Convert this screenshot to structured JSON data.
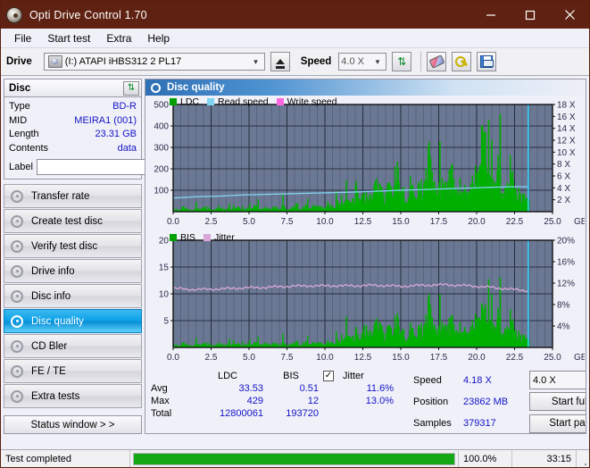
{
  "window": {
    "title": "Opti Drive Control 1.70",
    "icon": "disc-icon",
    "minimize": "minimize-icon",
    "maximize": "maximize-icon",
    "close": "close-icon"
  },
  "menu": {
    "items": [
      "File",
      "Start test",
      "Extra",
      "Help"
    ]
  },
  "toolbar": {
    "drive_label": "Drive",
    "drive_value": "(I:)   ATAPI iHBS312   2 PL17",
    "eject_icon": "eject-icon",
    "speed_label": "Speed",
    "speed_value": "4.0 X",
    "refresh_icon": "refresh-icon",
    "eraser_icon": "eraser-icon",
    "tools_icon": "tools-icon",
    "save_icon": "save-icon"
  },
  "disc": {
    "title": "Disc",
    "refresh_icon": "refresh-icon",
    "rows": [
      {
        "key": "Type",
        "value": "BD-R"
      },
      {
        "key": "MID",
        "value": "MEIRA1 (001)"
      },
      {
        "key": "Length",
        "value": "23.31 GB"
      },
      {
        "key": "Contents",
        "value": "data"
      }
    ],
    "label_key": "Label",
    "label_value": "",
    "label_placeholder": "",
    "disc_icon": "cd-icon"
  },
  "sidebar": {
    "items": [
      {
        "label": "Transfer rate",
        "active": false
      },
      {
        "label": "Create test disc",
        "active": false
      },
      {
        "label": "Verify test disc",
        "active": false
      },
      {
        "label": "Drive info",
        "active": false
      },
      {
        "label": "Disc info",
        "active": false
      },
      {
        "label": "Disc quality",
        "active": true
      },
      {
        "label": "CD Bler",
        "active": false
      },
      {
        "label": "FE / TE",
        "active": false
      },
      {
        "label": "Extra tests",
        "active": false
      }
    ],
    "status_window": "Status window > >"
  },
  "panel": {
    "title": "Disc quality",
    "icon": "disc-quality-icon"
  },
  "stats": {
    "col_headers": [
      "LDC",
      "BIS"
    ],
    "jitter_label": "Jitter",
    "jitter_checked": true,
    "rows": [
      {
        "key": "Avg",
        "ldc": "33.53",
        "bis": "0.51",
        "jitter": "11.6%"
      },
      {
        "key": "Max",
        "ldc": "429",
        "bis": "12",
        "jitter": "13.0%"
      },
      {
        "key": "Total",
        "ldc": "12800061",
        "bis": "193720",
        "jitter": ""
      }
    ],
    "speed_key": "Speed",
    "speed_value": "4.18 X",
    "speed_select": "4.0 X",
    "position_key": "Position",
    "position_value": "23862 MB",
    "samples_key": "Samples",
    "samples_value": "379317",
    "start_full": "Start full",
    "start_part": "Start part"
  },
  "statusbar": {
    "message": "Test completed",
    "percent": "100.0%",
    "percent_value": 100,
    "time": "33:15"
  },
  "colors": {
    "ldc_green": "#00b000",
    "read_speed_blue": "#7fd4f0",
    "write_speed_pink": "#ff66e0",
    "bis_green": "#00b000",
    "jitter_pink": "#d9a8d9",
    "plot_bg": "#6b7894",
    "grid": "#3a4358",
    "title_bar": "#5f2111",
    "accent_blue": "#1414c8",
    "progress_green": "#14a814"
  },
  "chart_data": [
    {
      "type": "area",
      "id": "ldc-chart",
      "title": "",
      "legend": [
        {
          "name": "LDC",
          "color": "#00a000"
        },
        {
          "name": "Read speed",
          "color": "#7fd4f0"
        },
        {
          "name": "Write speed",
          "color": "#ff66e0"
        }
      ],
      "legend_position": "top-left",
      "xlabel": "GB",
      "x_ticks": [
        "0.0",
        "2.5",
        "5.0",
        "7.5",
        "10.0",
        "12.5",
        "15.0",
        "17.5",
        "20.0",
        "22.5",
        "25.0"
      ],
      "xlim": [
        0.0,
        25.0
      ],
      "ylabel_left": "LDC",
      "y_ticks_left": [
        "100",
        "200",
        "300",
        "400",
        "500"
      ],
      "ylim_left": [
        0,
        500
      ],
      "ylabel_right": "Speed",
      "y_ticks_right": [
        "2 X",
        "4 X",
        "6 X",
        "8 X",
        "10 X",
        "12 X",
        "14 X",
        "16 X",
        "18 X"
      ],
      "ylim_right": [
        0,
        18
      ],
      "grid": true,
      "series": [
        {
          "name": "LDC",
          "color": "#00b000",
          "type": "vertical-bars",
          "x": [
            0.0,
            0.3,
            0.6,
            0.9,
            1.2,
            1.5,
            1.8,
            2.1,
            2.4,
            2.7,
            3.0,
            3.3,
            3.6,
            3.9,
            4.2,
            4.5,
            4.8,
            5.1,
            5.4,
            5.7,
            6.0,
            6.3,
            6.6,
            6.9,
            7.2,
            7.5,
            7.8,
            8.1,
            8.4,
            8.7,
            9.0,
            9.3,
            9.6,
            9.9,
            10.2,
            10.5,
            10.8,
            11.1,
            11.4,
            11.7,
            12.0,
            12.3,
            12.6,
            12.9,
            13.2,
            13.5,
            13.8,
            14.1,
            14.4,
            14.7,
            15.0,
            15.3,
            15.6,
            15.9,
            16.2,
            16.5,
            16.8,
            17.1,
            17.4,
            17.7,
            18.0,
            18.3,
            18.6,
            18.9,
            19.2,
            19.5,
            19.8,
            20.1,
            20.4,
            20.7,
            21.0,
            21.3,
            21.6,
            21.9,
            22.2,
            22.5,
            22.8,
            23.1,
            23.4
          ],
          "values": [
            14,
            10,
            22,
            12,
            9,
            18,
            11,
            25,
            14,
            10,
            30,
            12,
            16,
            11,
            28,
            9,
            18,
            13,
            35,
            11,
            20,
            14,
            26,
            12,
            32,
            10,
            22,
            40,
            16,
            30,
            14,
            38,
            18,
            26,
            50,
            20,
            44,
            28,
            60,
            34,
            120,
            75,
            95,
            62,
            110,
            150,
            85,
            130,
            100,
            240,
            115,
            90,
            175,
            96,
            140,
            105,
            300,
            120,
            98,
            160,
            104,
            230,
            112,
            145,
            108,
            125,
            190,
            155,
            430,
            175,
            120,
            260,
            142,
            118,
            250,
            108,
            95,
            70,
            60
          ]
        },
        {
          "name": "Read speed",
          "color": "#7fd4f0",
          "type": "line",
          "x": [
            0.0,
            1.5,
            3.0,
            4.5,
            6.0,
            7.5,
            9.0,
            10.5,
            12.0,
            13.5,
            15.0,
            16.5,
            18.0,
            19.5,
            21.0,
            22.5,
            23.4
          ],
          "values": [
            2.3,
            2.5,
            2.6,
            2.8,
            2.9,
            3.0,
            3.1,
            3.2,
            3.3,
            3.45,
            3.6,
            3.7,
            3.85,
            3.95,
            4.1,
            4.18,
            4.18
          ]
        }
      ],
      "vertical_marker_x": 23.4
    },
    {
      "type": "area",
      "id": "bis-chart",
      "title": "",
      "legend": [
        {
          "name": "BIS",
          "color": "#00a000"
        },
        {
          "name": "Jitter",
          "color": "#d9a8d9"
        }
      ],
      "legend_position": "top-left",
      "xlabel": "GB",
      "x_ticks": [
        "0.0",
        "2.5",
        "5.0",
        "7.5",
        "10.0",
        "12.5",
        "15.0",
        "17.5",
        "20.0",
        "22.5",
        "25.0"
      ],
      "xlim": [
        0.0,
        25.0
      ],
      "ylabel_left": "BIS",
      "y_ticks_left": [
        "5",
        "10",
        "15",
        "20"
      ],
      "ylim_left": [
        0,
        20
      ],
      "ylabel_right": "Jitter",
      "y_ticks_right": [
        "4%",
        "8%",
        "12%",
        "16%",
        "20%"
      ],
      "ylim_right": [
        0,
        20
      ],
      "grid": true,
      "series": [
        {
          "name": "BIS",
          "color": "#00b000",
          "type": "vertical-bars",
          "x": [
            0.0,
            0.3,
            0.6,
            0.9,
            1.2,
            1.5,
            1.8,
            2.1,
            2.4,
            2.7,
            3.0,
            3.3,
            3.6,
            3.9,
            4.2,
            4.5,
            4.8,
            5.1,
            5.4,
            5.7,
            6.0,
            6.3,
            6.6,
            6.9,
            7.2,
            7.5,
            7.8,
            8.1,
            8.4,
            8.7,
            9.0,
            9.3,
            9.6,
            9.9,
            10.2,
            10.5,
            10.8,
            11.1,
            11.4,
            11.7,
            12.0,
            12.3,
            12.6,
            12.9,
            13.2,
            13.5,
            13.8,
            14.1,
            14.4,
            14.7,
            15.0,
            15.3,
            15.6,
            15.9,
            16.2,
            16.5,
            16.8,
            17.1,
            17.4,
            17.7,
            18.0,
            18.3,
            18.6,
            18.9,
            19.2,
            19.5,
            19.8,
            20.1,
            20.4,
            20.7,
            21.0,
            21.3,
            21.6,
            21.9,
            22.2,
            22.5,
            22.8,
            23.1,
            23.4
          ],
          "values": [
            0.6,
            0.4,
            0.8,
            0.5,
            0.4,
            0.7,
            0.5,
            0.9,
            0.6,
            0.4,
            1.0,
            0.5,
            0.7,
            0.5,
            0.9,
            0.4,
            0.7,
            0.5,
            1.1,
            0.5,
            0.8,
            0.6,
            0.9,
            0.5,
            1.0,
            0.5,
            0.8,
            1.2,
            0.7,
            1.0,
            0.6,
            1.1,
            0.7,
            0.9,
            1.4,
            0.8,
            1.3,
            0.9,
            2.4,
            1.5,
            3.2,
            2.0,
            4.5,
            2.6,
            3.6,
            5.5,
            2.9,
            4.0,
            3.2,
            6.5,
            3.4,
            2.8,
            5.0,
            3.0,
            4.2,
            3.2,
            9.2,
            3.6,
            3.0,
            4.8,
            3.2,
            6.2,
            3.4,
            4.4,
            3.3,
            3.8,
            5.6,
            4.6,
            8.0,
            5.2,
            3.6,
            7.2,
            4.2,
            3.5,
            6.8,
            3.2,
            2.6,
            2.0,
            1.6
          ]
        },
        {
          "name": "Jitter",
          "color": "#d9a8d9",
          "type": "line",
          "x": [
            0.0,
            1.5,
            3.0,
            4.5,
            6.0,
            7.5,
            9.0,
            10.5,
            12.0,
            13.5,
            15.0,
            16.5,
            18.0,
            19.5,
            21.0,
            22.5,
            23.4
          ],
          "values": [
            11.0,
            10.8,
            10.9,
            11.1,
            11.2,
            11.4,
            11.5,
            11.5,
            11.5,
            11.6,
            11.4,
            11.6,
            11.7,
            11.5,
            11.2,
            10.8,
            10.6
          ]
        }
      ],
      "vertical_marker_x": 23.4
    }
  ]
}
